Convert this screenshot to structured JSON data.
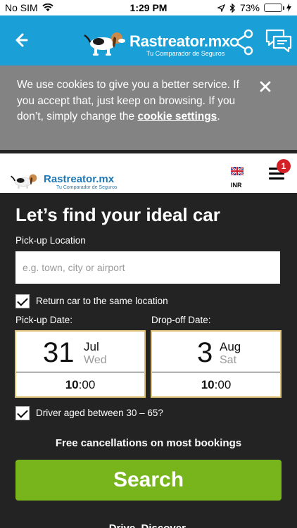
{
  "status_bar": {
    "carrier": "No SIM",
    "time": "1:29 PM",
    "battery": "73%"
  },
  "app_header": {
    "brand": "Rastreator.mx",
    "tagline": "Tu Comparador de Seguros"
  },
  "cookie_banner": {
    "text_before": "We use cookies to give you a better service. If you accept that, just keep on browsing. If you don’t, simply change the ",
    "link_text": "cookie settings",
    "text_after": "."
  },
  "site_header": {
    "brand": "Rastreator.mx",
    "tagline": "Tu Comparador de Seguros",
    "currency": "INR",
    "notification_count": "1"
  },
  "form": {
    "title": "Let’s find your ideal car",
    "pickup_location_label": "Pick-up Location",
    "pickup_location_placeholder": "e.g. town, city or airport",
    "return_same_location_label": "Return car to the same location",
    "pickup_date_label": "Pick-up Date:",
    "dropoff_date_label": "Drop-off Date:",
    "pickup": {
      "day": "31",
      "month": "Jul",
      "weekday": "Wed",
      "hour": "10",
      "minutes": ":00"
    },
    "dropoff": {
      "day": "3",
      "month": "Aug",
      "weekday": "Sat",
      "hour": "10",
      "minutes": ":00"
    },
    "driver_age_label": "Driver aged between 30 – 65?",
    "free_cancellations": "Free cancellations on most bookings",
    "search_button": "Search",
    "footer_partial": "Drive. Discover."
  },
  "colors": {
    "header_blue": "#1aa0d6",
    "cookie_gray": "#838383",
    "search_green": "#78b41c",
    "form_bg": "#232323"
  }
}
